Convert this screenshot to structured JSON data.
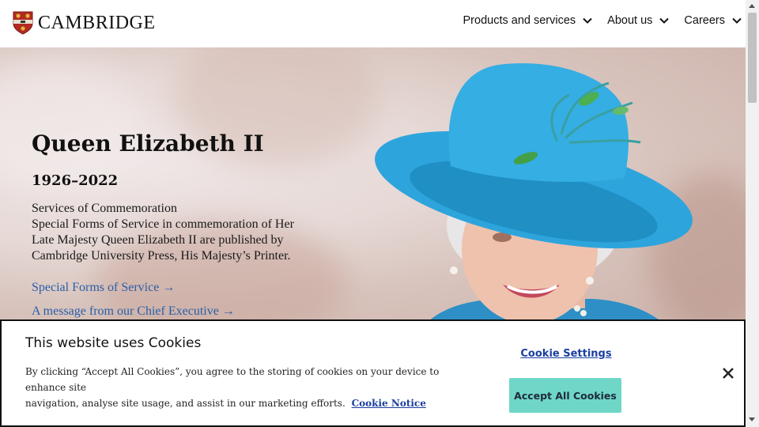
{
  "header": {
    "logo_text": "CAMBRIDGE",
    "nav": [
      {
        "label": "Products and services"
      },
      {
        "label": "About us"
      },
      {
        "label": "Careers"
      }
    ]
  },
  "hero": {
    "title": "Queen Elizabeth II",
    "dates": "1926–2022",
    "body_lines": [
      "Services of Commemoration",
      "Special Forms of Service in commemoration of Her",
      "Late Majesty Queen Elizabeth II are published by",
      "Cambridge University Press, His Majesty’s Printer."
    ],
    "links": [
      {
        "label": "Special Forms of Service →"
      },
      {
        "label": "A message from our Chief Executive →"
      }
    ]
  },
  "cookie": {
    "title": "This website uses Cookies",
    "description_line1": "By clicking “Accept All Cookies”, you agree to the storing of cookies on your device to enhance site",
    "description_line2": "navigation, analyse site usage, and assist in our marketing efforts.",
    "notice_link": "Cookie Notice",
    "settings_label": "Cookie Settings",
    "accept_label": "Accept All Cookies"
  },
  "colors": {
    "link": "#2a5ea8",
    "accept_button": "#6fd6c8",
    "hat": "#2ea4dc"
  }
}
